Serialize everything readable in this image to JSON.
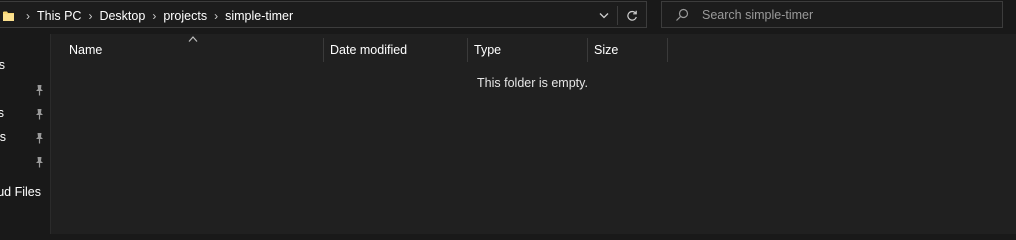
{
  "address_bar": {
    "breadcrumbs": [
      "This PC",
      "Desktop",
      "projects",
      "simple-timer"
    ],
    "folder_icon": "folder-icon",
    "dropdown_icon": "chevron-down-icon",
    "refresh_icon": "refresh-icon"
  },
  "search": {
    "placeholder": "Search simple-timer",
    "value": ""
  },
  "nav_pane": {
    "items": [
      {
        "label": "s",
        "pinned": false
      },
      {
        "label": "",
        "pinned": true
      },
      {
        "label": "s",
        "pinned": true
      },
      {
        "label": "ts",
        "pinned": true
      },
      {
        "label": "",
        "pinned": true
      },
      {
        "label": "ud Files",
        "pinned": false
      }
    ]
  },
  "file_list": {
    "columns": [
      "Name",
      "Date modified",
      "Type",
      "Size"
    ],
    "sort_column": "Name",
    "sort_direction": "ascending",
    "empty_message": "This folder is empty."
  },
  "colors": {
    "background": "#191919",
    "content_background": "#202020",
    "border": "#3c3c3c",
    "folder": "#f8d775"
  }
}
